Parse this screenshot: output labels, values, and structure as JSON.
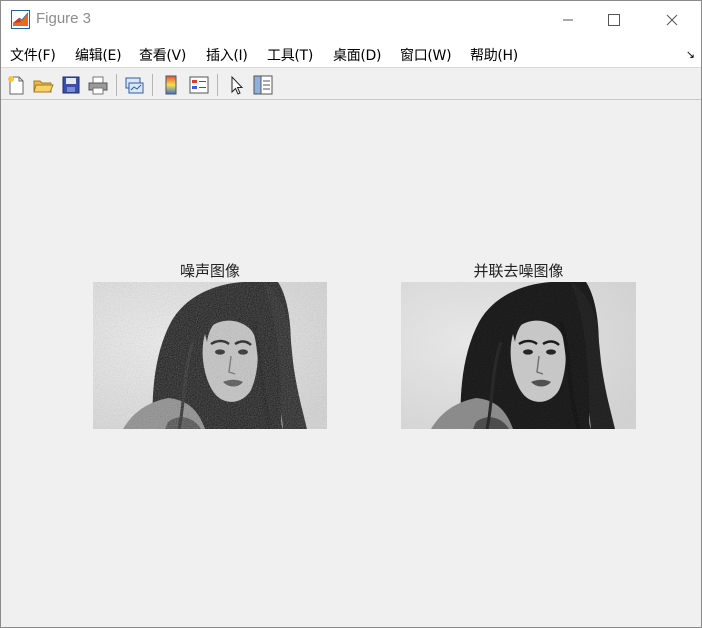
{
  "window": {
    "title": "Figure 3"
  },
  "menubar": {
    "items": [
      "文件(F)",
      "编辑(E)",
      "查看(V)",
      "插入(I)",
      "工具(T)",
      "桌面(D)",
      "窗口(W)",
      "帮助(H)"
    ],
    "corner_icon": "dock-arrow-icon"
  },
  "toolbar": {
    "icons": [
      "new-figure-icon",
      "open-file-icon",
      "save-icon",
      "print-icon",
      "link-plot-icon",
      "colorbar-icon",
      "legend-icon",
      "pointer-icon",
      "property-inspector-icon"
    ]
  },
  "figure": {
    "axes": [
      {
        "title": "噪声图像"
      },
      {
        "title": "并联去噪图像"
      }
    ]
  }
}
